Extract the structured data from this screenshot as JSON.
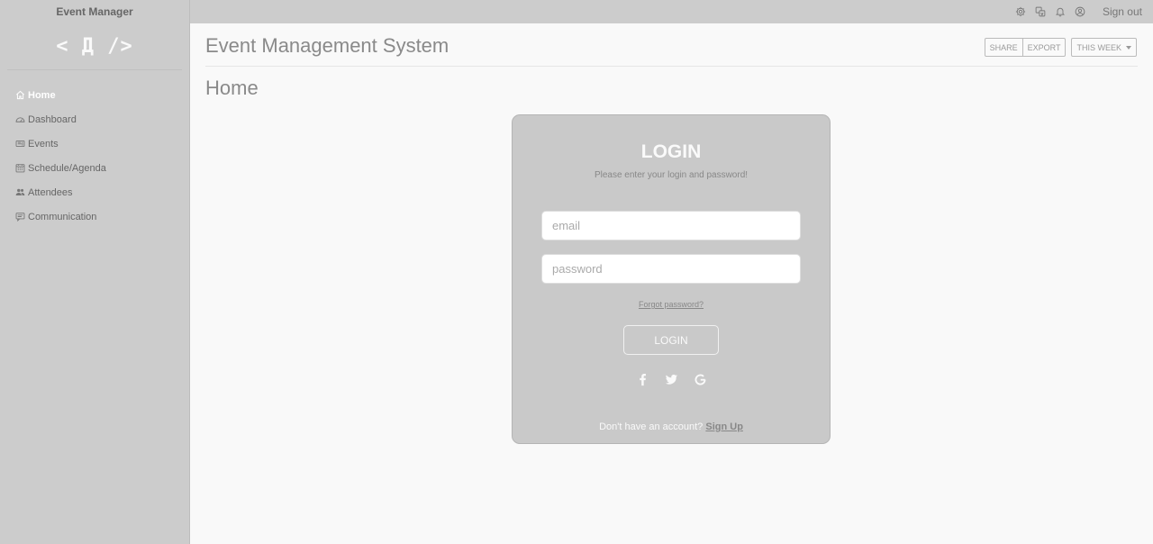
{
  "app": {
    "brand": "Event Manager",
    "logo_text": "< Д />"
  },
  "topbar": {
    "icons": [
      "settings-icon",
      "translate-icon",
      "bell-icon",
      "user-circle-icon"
    ],
    "sign_out": "Sign out"
  },
  "sidebar": {
    "items": [
      {
        "label": "Home",
        "icon": "home-icon",
        "active": true
      },
      {
        "label": "Dashboard",
        "icon": "speedometer-icon",
        "active": false
      },
      {
        "label": "Events",
        "icon": "ticket-icon",
        "active": false
      },
      {
        "label": "Schedule/Agenda",
        "icon": "calendar-icon",
        "active": false
      },
      {
        "label": "Attendees",
        "icon": "people-icon",
        "active": false
      },
      {
        "label": "Communication",
        "icon": "chat-icon",
        "active": false
      }
    ]
  },
  "header": {
    "title": "Event Management System",
    "share_label": "SHARE",
    "export_label": "EXPORT",
    "range_label": "THIS WEEK"
  },
  "page": {
    "title": "Home"
  },
  "login": {
    "title": "LOGIN",
    "subtitle": "Please enter your login and password!",
    "email_placeholder": "email",
    "password_placeholder": "password",
    "forgot": "Forgot password?",
    "button": "LOGIN",
    "socials": [
      "facebook-icon",
      "twitter-icon",
      "google-icon"
    ],
    "signup_prompt": "Don't have an account?",
    "signup_link": "Sign Up"
  },
  "colors": {
    "sidebar_bg": "#cccccc",
    "card_bg": "#c9c9c9",
    "page_bg": "#f9f9f9",
    "text_light": "#fafafa"
  }
}
